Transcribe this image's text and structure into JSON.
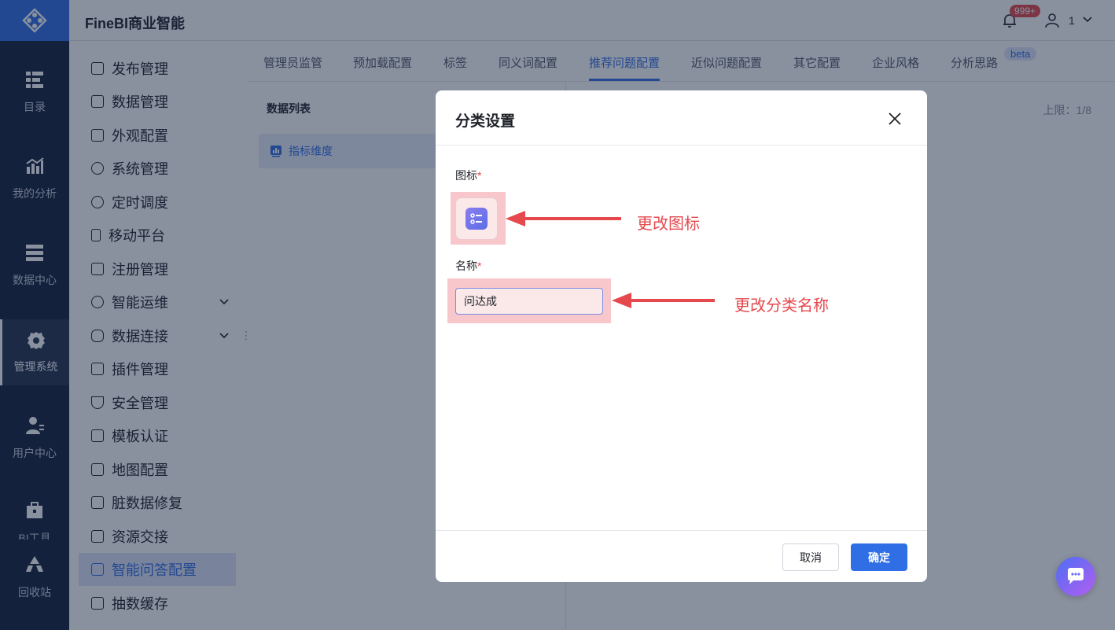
{
  "app": {
    "title": "FineBI商业智能"
  },
  "header": {
    "notification_badge": "999+",
    "user_name": "1"
  },
  "rail": {
    "items": [
      {
        "label": "目录",
        "icon": "catalog-icon"
      },
      {
        "label": "我的分析",
        "icon": "analysis-icon"
      },
      {
        "label": "数据中心",
        "icon": "data-center-icon"
      },
      {
        "label": "管理系统",
        "icon": "management-icon",
        "active": true
      },
      {
        "label": "用户中心",
        "icon": "user-center-icon"
      },
      {
        "label": "BI工具",
        "icon": "bi-tools-icon"
      },
      {
        "label": "回收站",
        "icon": "recycle-bin-icon"
      }
    ]
  },
  "menu": {
    "items": [
      {
        "label": "发布管理"
      },
      {
        "label": "数据管理"
      },
      {
        "label": "外观配置"
      },
      {
        "label": "系统管理"
      },
      {
        "label": "定时调度"
      },
      {
        "label": "移动平台"
      },
      {
        "label": "注册管理"
      },
      {
        "label": "智能运维",
        "expandable": true
      },
      {
        "label": "数据连接",
        "expandable": true
      },
      {
        "label": "插件管理"
      },
      {
        "label": "安全管理"
      },
      {
        "label": "模板认证"
      },
      {
        "label": "地图配置"
      },
      {
        "label": "脏数据修复"
      },
      {
        "label": "资源交接"
      },
      {
        "label": "智能问答配置",
        "active": true
      },
      {
        "label": "抽数缓存"
      }
    ]
  },
  "tabs": [
    {
      "label": "管理员监管"
    },
    {
      "label": "预加载配置"
    },
    {
      "label": "标签"
    },
    {
      "label": "同义词配置"
    },
    {
      "label": "推荐问题配置",
      "active": true
    },
    {
      "label": "近似问题配置"
    },
    {
      "label": "其它配置"
    },
    {
      "label": "企业风格"
    },
    {
      "label": "分析思路"
    }
  ],
  "tab_badge": "beta",
  "content": {
    "list_title": "数据列表",
    "list_item": "指标维度",
    "limit": "上限：1/8"
  },
  "modal": {
    "title": "分类设置",
    "icon_label": "图标",
    "name_label": "名称",
    "required_mark": "*",
    "name_value": "问达成",
    "cancel": "取消",
    "confirm": "确定"
  },
  "annotations": {
    "change_icon": "更改图标",
    "change_name": "更改分类名称"
  },
  "colors": {
    "accent": "#2f6ee4",
    "rail_bg": "#14213d",
    "annotation_red": "#e5484d",
    "highlight": "#f7c7cb"
  }
}
